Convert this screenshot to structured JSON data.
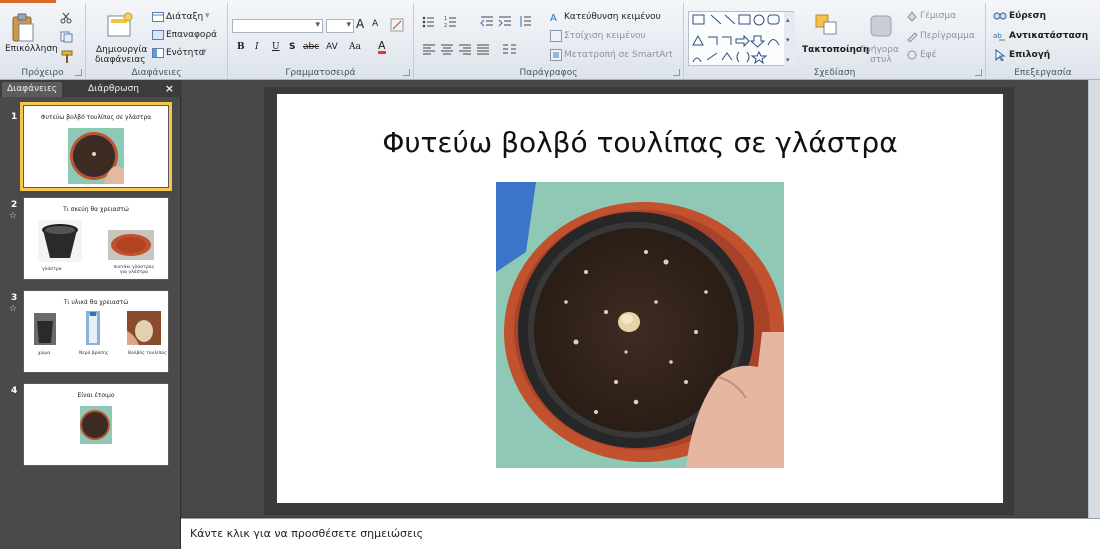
{
  "ribbon": {
    "clipboard": {
      "paste_label": "Επικόλληση",
      "group_label": "Πρόχειρο"
    },
    "slides": {
      "new_slide_label_line1": "Δημιουργία",
      "new_slide_label_line2": "διαφάνειας",
      "layout_label": "Διάταξη",
      "reset_label": "Επαναφορά",
      "section_label": "Ενότητα",
      "group_label": "Διαφάνειες"
    },
    "font": {
      "font_name_value": "",
      "font_size_value": "",
      "bold": "B",
      "italic": "I",
      "underline": "U",
      "shadow": "S",
      "strike": "abc",
      "spacing": "AV",
      "case": "Aa",
      "color": "A",
      "grow": "A",
      "shrink": "A",
      "group_label": "Γραμματοσειρά"
    },
    "paragraph": {
      "text_direction_label": "Κατεύθυνση κειμένου",
      "align_text_label": "Στοίχιση κειμένου",
      "smartart_label": "Μετατροπή σε SmartArt",
      "group_label": "Παράγραφος"
    },
    "drawing": {
      "arrange_label": "Τακτοποίηση",
      "quick_styles_line1": "Γρήγορα",
      "quick_styles_line2": "στυλ",
      "fill_label": "Γέμισμα",
      "outline_label": "Περίγραμμα",
      "effects_label": "Εφέ",
      "group_label": "Σχεδίαση"
    },
    "editing": {
      "find_label": "Εύρεση",
      "replace_label": "Αντικατάσταση",
      "select_label": "Επιλογή",
      "group_label": "Επεξεργασία"
    }
  },
  "panel": {
    "tab_slides": "Διαφάνειες",
    "tab_outline": "Διάρθρωση",
    "close_glyph": "×",
    "thumbnails": [
      {
        "number": "1",
        "title": "Φυτεύω βολβό τουλίπας σε γλάστρα",
        "captions": []
      },
      {
        "number": "2",
        "title": "Τι σκεύη θα χρειαστώ",
        "captions": [
          "γλάστρα",
          "πιατάκι γλάστρας για γλάστρα"
        ]
      },
      {
        "number": "3",
        "title": "Τι υλικά θα χρειαστώ",
        "captions": [
          "χώμα",
          "Νερό βρύσης",
          "Βολβός τουλίπας"
        ]
      },
      {
        "number": "4",
        "title": "Είναι έτοιμο",
        "captions": []
      }
    ]
  },
  "slide": {
    "title": "Φυτεύω βολβό τουλίπας σε γλάστρα"
  },
  "notes": {
    "placeholder": "Κάντε κλικ για να προσθέσετε σημειώσεις"
  },
  "colors": {
    "accent": "#d86b2b",
    "selected_thumb": "#f7c64b",
    "pot": "#2f2f2f",
    "soil": "#3e2c22",
    "saucer": "#c2512e",
    "water_bg": "#8fc9b6"
  }
}
